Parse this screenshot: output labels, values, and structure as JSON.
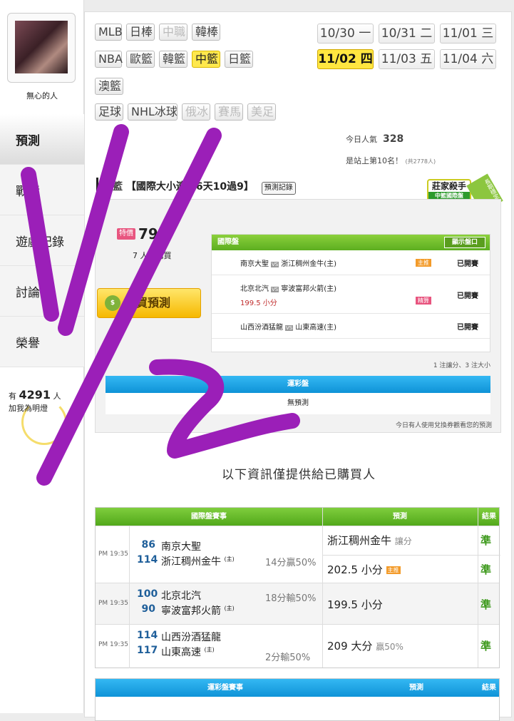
{
  "user": {
    "name": "無心的人",
    "fans_prefix": "有",
    "fans_count": "4291",
    "fans_suffix": "人",
    "fans_text": "加我為明燈"
  },
  "sidebar": {
    "items": [
      "預測",
      "戰績",
      "遊戲記錄",
      "討論",
      "榮譽"
    ]
  },
  "sports_rows": [
    [
      {
        "label": "MLB",
        "state": ""
      },
      {
        "label": "日棒",
        "state": ""
      },
      {
        "label": "中職",
        "state": "disabled"
      },
      {
        "label": "韓棒",
        "state": ""
      }
    ],
    [
      {
        "label": "NBA",
        "state": ""
      },
      {
        "label": "歐籃",
        "state": ""
      },
      {
        "label": "韓籃",
        "state": ""
      },
      {
        "label": "中籃",
        "state": "active"
      },
      {
        "label": "日籃",
        "state": ""
      }
    ],
    [
      {
        "label": "澳籃",
        "state": ""
      }
    ],
    [
      {
        "label": "足球",
        "state": ""
      },
      {
        "label": "NHL冰球",
        "state": ""
      },
      {
        "label": "俄冰",
        "state": "disabled"
      },
      {
        "label": "賽馬",
        "state": "disabled"
      },
      {
        "label": "美足",
        "state": "disabled"
      }
    ]
  ],
  "dates": [
    {
      "date": "10/30",
      "day": "一",
      "active": false
    },
    {
      "date": "10/31",
      "day": "二",
      "active": false
    },
    {
      "date": "11/01",
      "day": "三",
      "active": false
    },
    {
      "date": "11/02",
      "day": "四",
      "active": true
    },
    {
      "date": "11/03",
      "day": "五",
      "active": false
    },
    {
      "date": "11/04",
      "day": "六",
      "active": false
    }
  ],
  "stats": {
    "popularity_label": "今日人氣",
    "popularity": "328",
    "rank_text": "是站上第10名！",
    "rank_note": "(共2778人)"
  },
  "prediction": {
    "sport": "中籃",
    "title": "【國際大小連莊6天10過9】",
    "record_button": "預測記錄"
  },
  "badge": {
    "title": "莊家殺手",
    "subtitle": "中籃國際盤",
    "ribbon": "長期穩定"
  },
  "pricing": {
    "tag": "特價",
    "price": "79",
    "unit": "元",
    "buyers": "7 人已購買",
    "buy_button": "購買預測"
  },
  "intl_box": {
    "title": "國際盤",
    "odds_button": "顯示盤口",
    "rows": [
      {
        "home": "南京大聖",
        "away": "浙江稠州金牛(主)",
        "tag": "主推",
        "extra": "",
        "status": "已開賽"
      },
      {
        "home": "北京北汽",
        "away": "寧波富邦火箭(主)",
        "tag": "精算",
        "extra": "199.5 小分",
        "status": "已開賽"
      },
      {
        "home": "山西汾酒猛龍",
        "away": "山東高速(主)",
        "tag": "",
        "extra": "",
        "status": "已開賽"
      }
    ],
    "footer": "1 注讓分、3 注大小"
  },
  "lottery_box": {
    "title": "運彩盤",
    "body": "無預測",
    "note": "今日有人使用兌換券觀看您的預測"
  },
  "buyers_only": "以下資訊僅提供給已購買人",
  "results_table": {
    "headers": [
      "國際盤賽事",
      "預測",
      "結果"
    ],
    "matches": [
      {
        "time": "PM 19:35",
        "away_score": "86",
        "away": "南京大聖",
        "home_score": "114",
        "home": "浙江稠州金牛",
        "home_mark": "(主)",
        "result": "14分贏50%",
        "pred1": "浙江稠州金牛",
        "pred1_note": "讓分",
        "pred1_ok": "準",
        "pred2": "202.5 小分",
        "pred2_tag": "主推",
        "pred2_ok": "準"
      },
      {
        "time": "PM 19:35",
        "away_score": "100",
        "away": "北京北汽",
        "home_score": "90",
        "home": "寧波富邦火箭",
        "home_mark": "(主)",
        "result": "18分輸50%",
        "pred1": "199.5 小分",
        "pred1_ok": "準"
      },
      {
        "time": "PM 19:35",
        "away_score": "114",
        "away": "山西汾酒猛龍",
        "home_score": "117",
        "home": "山東高速",
        "home_mark": "(主)",
        "result": "2分輸50%",
        "pred1": "209 大分",
        "pred1_note": "贏50%",
        "pred1_ok": "準"
      }
    ]
  },
  "lottery_table": {
    "headers": [
      "運彩盤賽事",
      "預測",
      "結果"
    ]
  },
  "colors": {
    "green": "#5cae20",
    "blue": "#0f93d7",
    "yellow": "#ffe84d",
    "scribble": "#9b1fb8"
  }
}
